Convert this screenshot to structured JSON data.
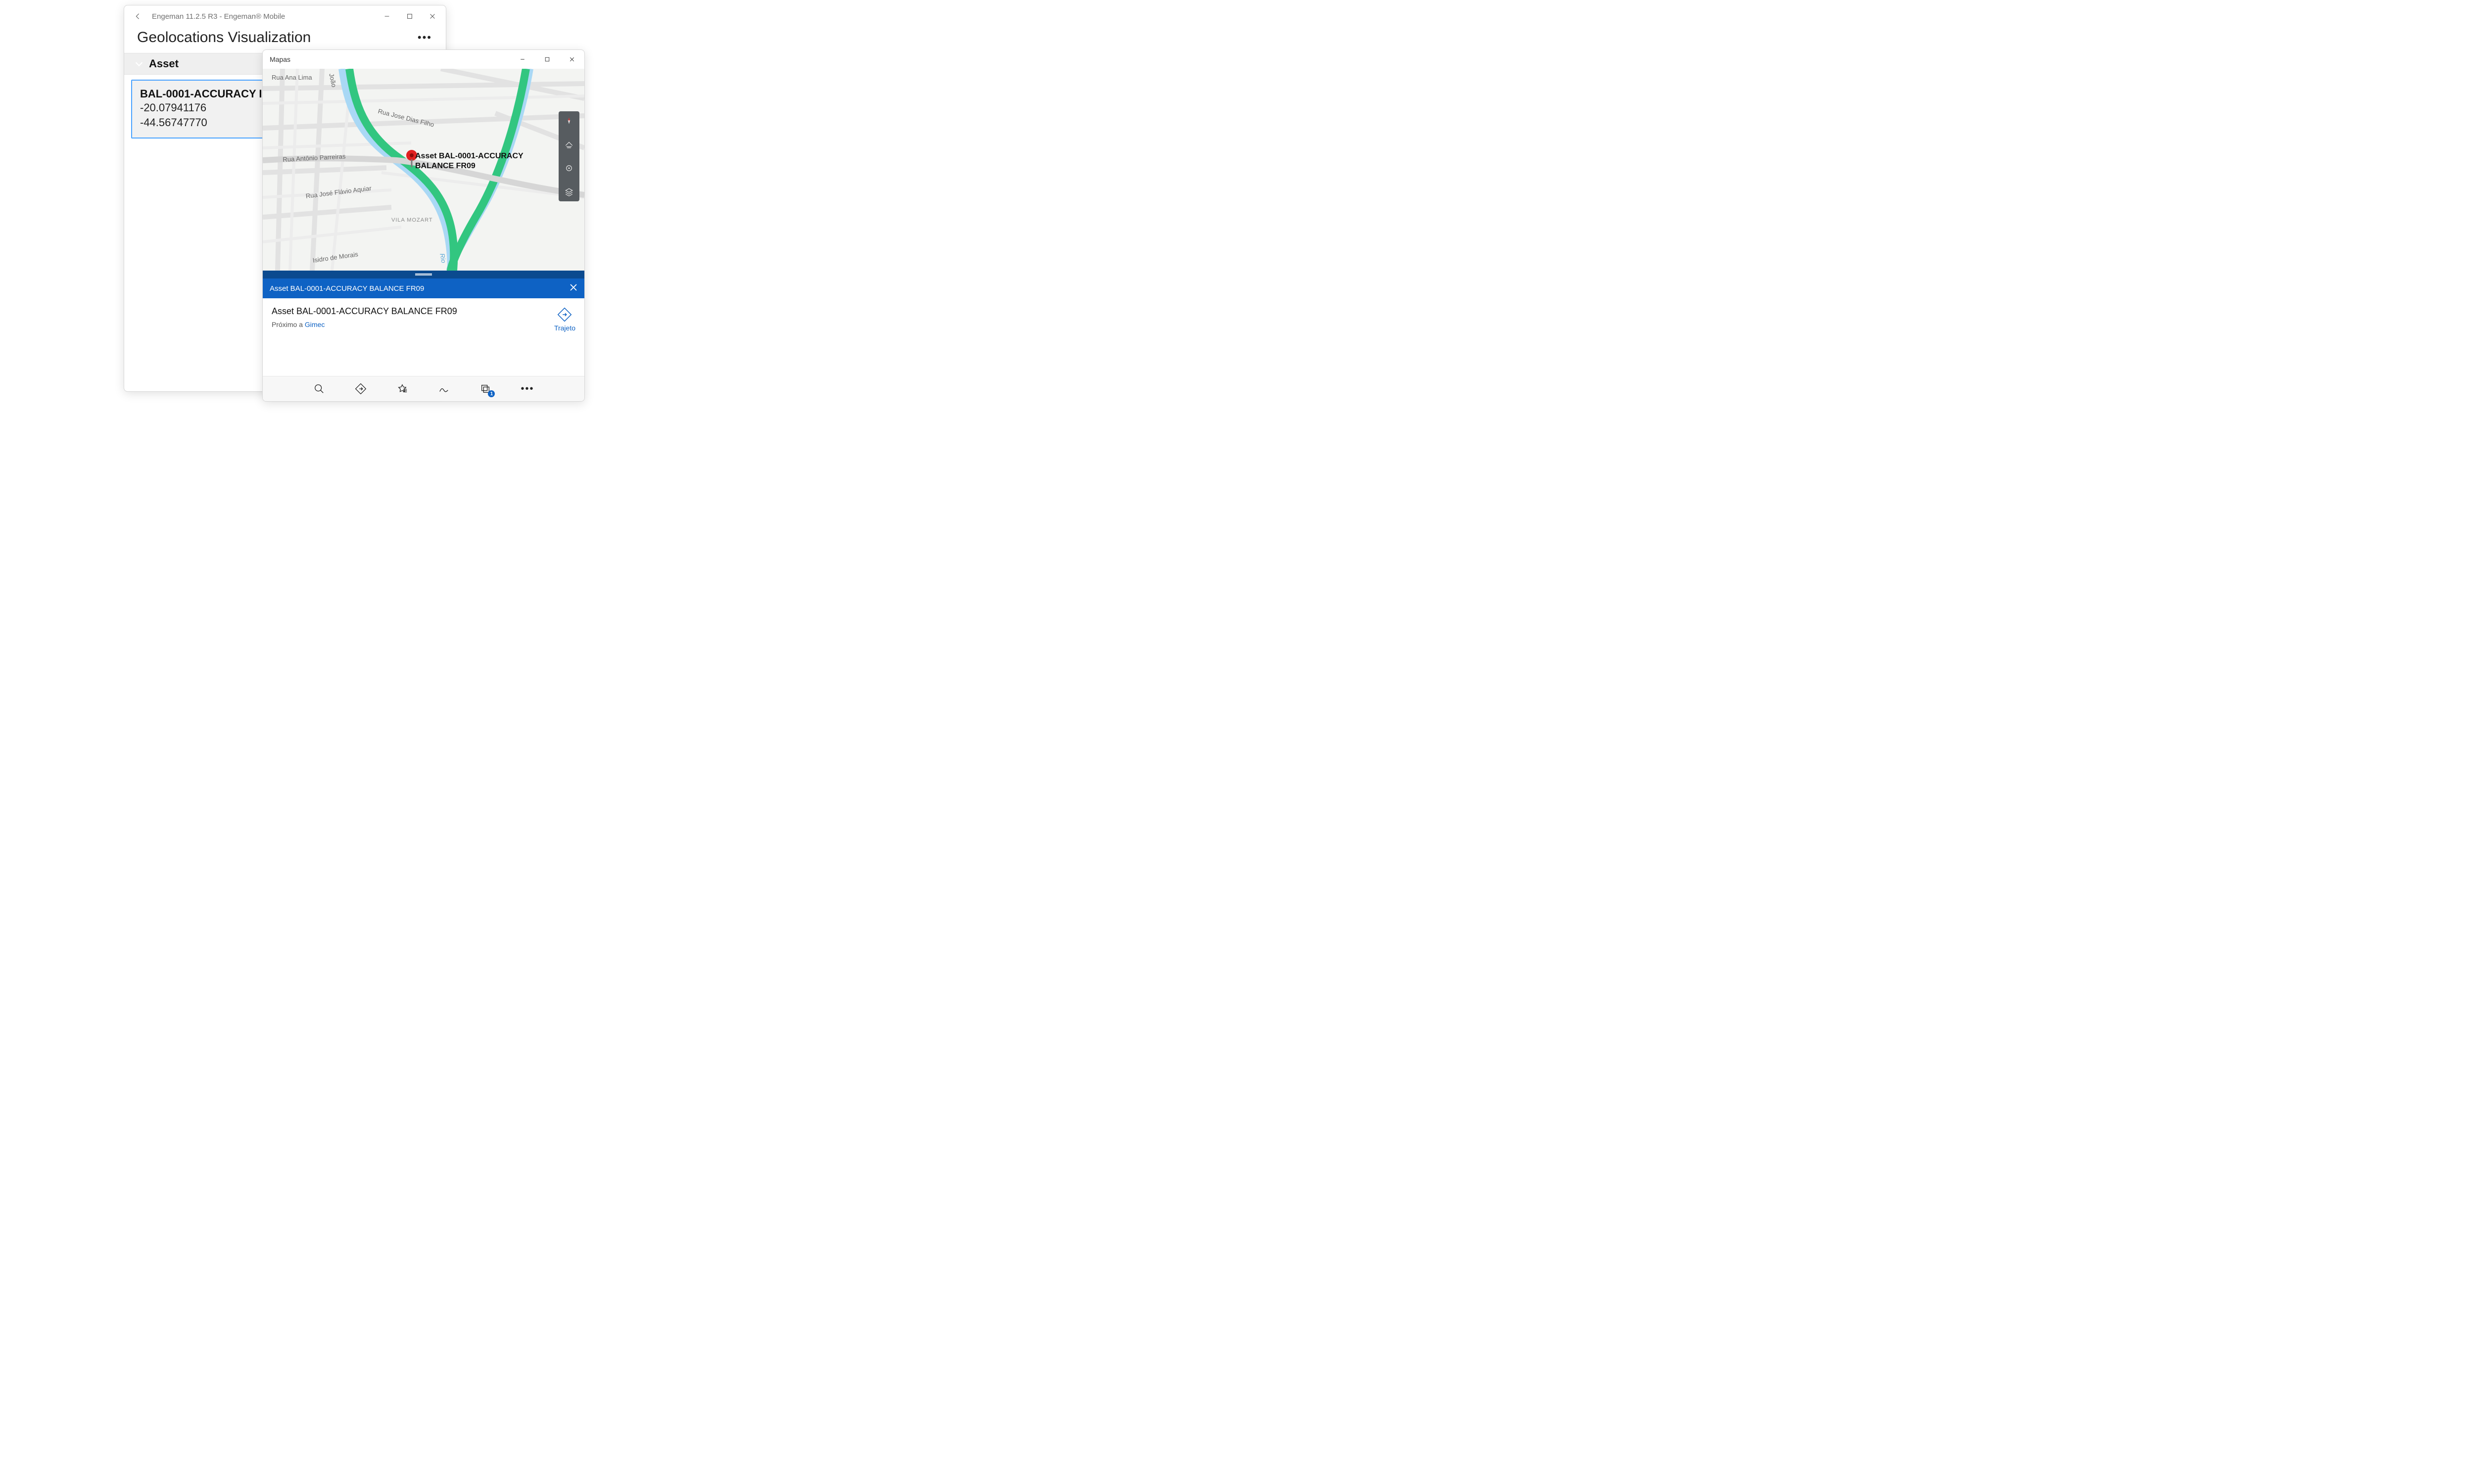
{
  "engeman": {
    "window_title": "Engeman 11.2.5 R3 - Engeman® Mobile",
    "page_title": "Geolocations Visualization",
    "section_label": "Asset",
    "asset": {
      "code_line": "BAL-0001-ACCURACY I",
      "lat": "-20.07941176",
      "lon": "-44.56747770"
    }
  },
  "maps": {
    "window_title": "Mapas",
    "pin_label": "Asset BAL-0001-ACCURACY BALANCE FR09",
    "streets": {
      "ana_lima": "Rua Ana Lima",
      "joao": "João",
      "jose_dias": "Rua Jose Dias Filho",
      "parreiras": "Rua Antônio Parreiras",
      "aquiar": "Rua José Flávio Aquiar",
      "morais": "Isidro de Morais",
      "rio": "Rio"
    },
    "area": "VILA MOZART",
    "info_bar_title": "Asset BAL-0001-ACCURACY BALANCE FR09",
    "detail_title": "Asset BAL-0001-ACCURACY BALANCE FR09",
    "near_prefix": "Próximo a ",
    "near_place": "Gimec",
    "trajeto_label": "Trajeto",
    "tabs_badge": "1"
  }
}
